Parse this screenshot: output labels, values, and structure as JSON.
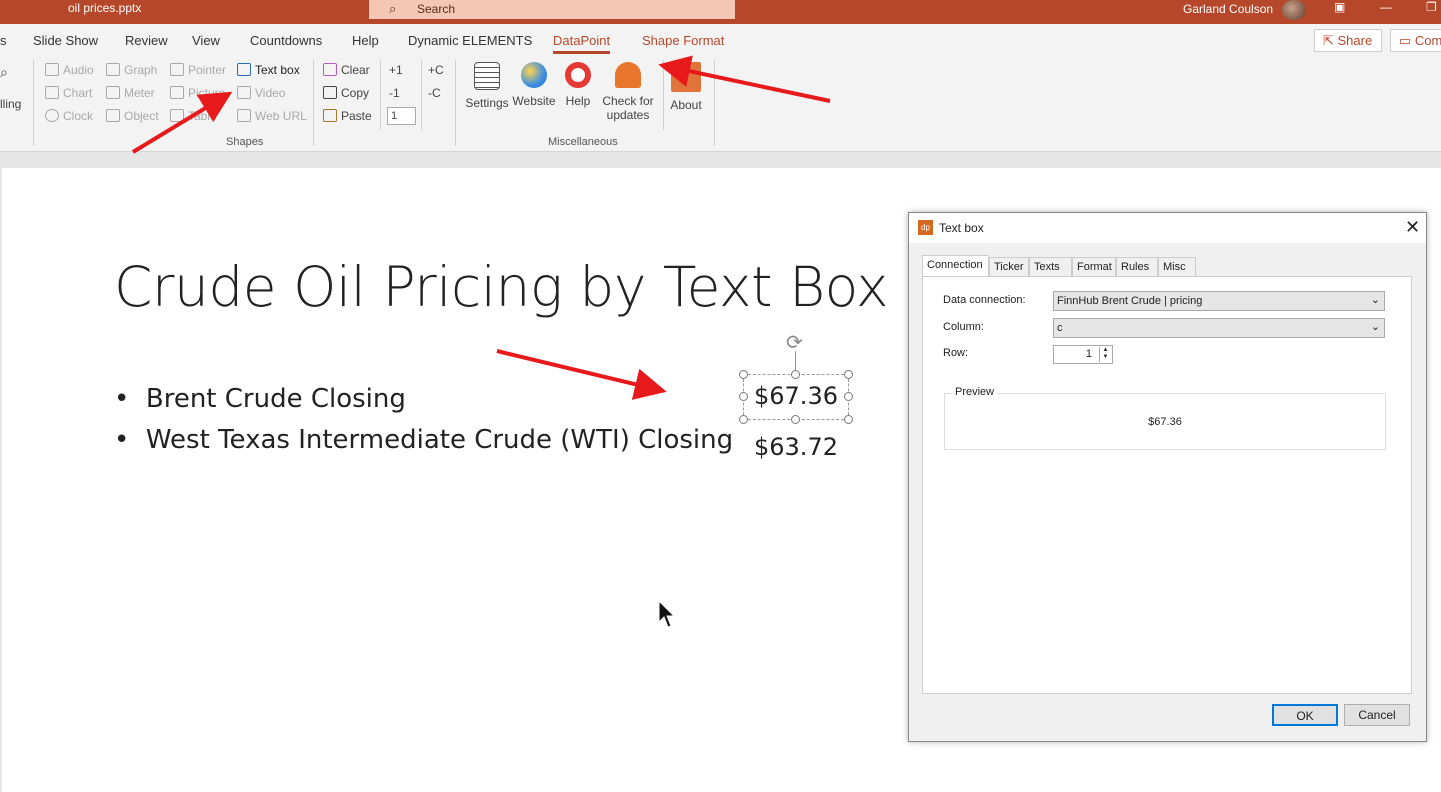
{
  "titlebar": {
    "file_name": "oil prices.pptx",
    "search_placeholder": "Search",
    "user_name": "Garland Coulson"
  },
  "tabs": {
    "items": [
      "Slide Show",
      "Review",
      "View",
      "Countdowns",
      "Help",
      "Dynamic ELEMENTS",
      "DataPoint",
      "Shape Format"
    ],
    "active": "DataPoint",
    "share_label": "Share",
    "comments_label": "Com",
    "left_cut": "s"
  },
  "ribbon": {
    "left_cut_label": "lling",
    "shapes": {
      "col1": [
        "Audio",
        "Chart",
        "Clock"
      ],
      "col2": [
        "Graph",
        "Meter",
        "Object"
      ],
      "col3": [
        "Pointer",
        "Picture",
        "Table"
      ],
      "col4": [
        "Text box",
        "Video",
        "Web URL"
      ],
      "group_label": "Shapes"
    },
    "edit": {
      "clear": "Clear",
      "copy": "Copy",
      "paste": "Paste",
      "plus1": "+1",
      "minus1": "-1",
      "step_value": "1",
      "plusC": "+C",
      "minusC": "-C"
    },
    "misc": {
      "settings": "Settings",
      "website": "Website",
      "help": "Help",
      "check_line1": "Check for",
      "check_line2": "updates",
      "about": "About",
      "group_label": "Miscellaneous"
    }
  },
  "slide": {
    "title": "Crude Oil Pricing by Text Box",
    "bullets": [
      "Brent Crude Closing",
      "West Texas Intermediate Crude (WTI) Closing"
    ],
    "value_selected": "$67.36",
    "value_second": "$63.72"
  },
  "dialog": {
    "title": "Text box",
    "icon_text": "dp",
    "tabs": [
      "Connection",
      "Ticker",
      "Texts",
      "Format",
      "Rules",
      "Misc"
    ],
    "active_tab": "Connection",
    "data_connection_label": "Data connection:",
    "data_connection_value": "FinnHub Brent Crude | pricing",
    "column_label": "Column:",
    "column_value": "c",
    "row_label": "Row:",
    "row_value": "1",
    "preview_label": "Preview",
    "preview_value": "$67.36",
    "ok_label": "OK",
    "cancel_label": "Cancel"
  },
  "colors": {
    "accent": "#b7472a",
    "arrow": "#e8191a"
  }
}
